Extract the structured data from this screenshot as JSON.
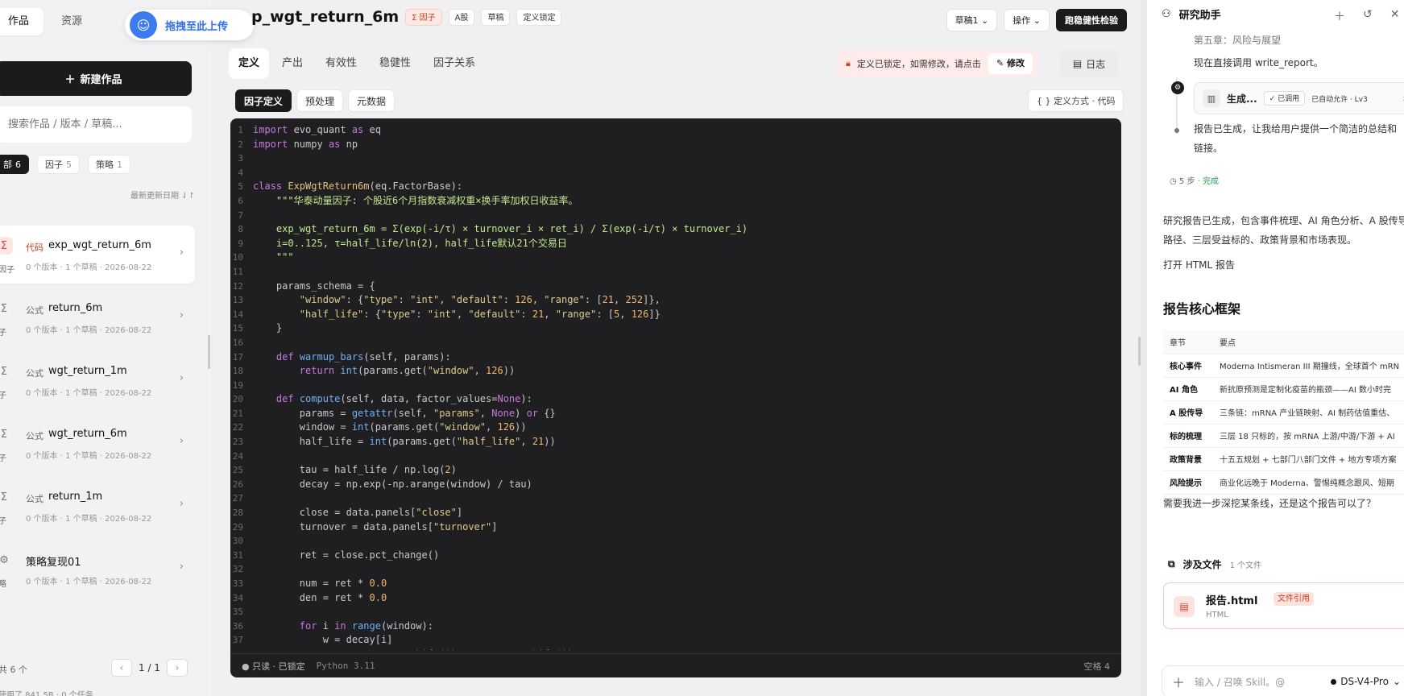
{
  "left": {
    "tabs": [
      "作品",
      "资源"
    ],
    "upload_label": "拖拽至此上传",
    "new_button": "新建作品",
    "search_placeholder": "搜索作品 / 版本 / 草稿...",
    "chips": [
      {
        "label": "部",
        "count": "6"
      },
      {
        "label": "因子",
        "count": "5"
      },
      {
        "label": "策略",
        "count": "1"
      }
    ],
    "sort_label": "最新更新日期 ⇃↾",
    "items": [
      {
        "icon": "Σ",
        "icon_label": "因子",
        "tag": "代码",
        "name": "exp_wgt_return_6m",
        "meta": "0 个版本 · 1 个草稿 · 2026-08-22"
      },
      {
        "icon": "Σ",
        "icon_label": "子",
        "tag": "公式",
        "name": "return_6m",
        "meta": "0 个版本 · 1 个草稿 · 2026-08-22"
      },
      {
        "icon": "Σ",
        "icon_label": "子",
        "tag": "公式",
        "name": "wgt_return_1m",
        "meta": "0 个版本 · 1 个草稿 · 2026-08-22"
      },
      {
        "icon": "Σ",
        "icon_label": "子",
        "tag": "公式",
        "name": "wgt_return_6m",
        "meta": "0 个版本 · 1 个草稿 · 2026-08-22"
      },
      {
        "icon": "Σ",
        "icon_label": "子",
        "tag": "公式",
        "name": "return_1m",
        "meta": "0 个版本 · 1 个草稿 · 2026-08-22"
      },
      {
        "icon": "⚙",
        "icon_label": "略",
        "tag": "",
        "name": "策略复现01",
        "meta": "0 个版本 · 1 个草稿 · 2026-08-22"
      }
    ],
    "total": "共 6 个",
    "page": "1 / 1",
    "footer": "使用了 841.5B · 0 个任务"
  },
  "main": {
    "title": "p_wgt_return_6m",
    "badges": [
      "Σ 因子",
      "A股",
      "草稿",
      "定义锁定"
    ],
    "draft_select": "草稿1 ⌄",
    "ops_select": "操作 ⌄",
    "robustness_button": "跑稳健性检验",
    "tabs": [
      "定义",
      "产出",
      "有效性",
      "稳健性",
      "因子关系"
    ],
    "lock_notice": "定义已锁定，如需修改，请点击",
    "edit_button": "✎ 修改",
    "log_button": "日志",
    "subtabs": [
      "因子定义",
      "预处理",
      "元数据"
    ],
    "def_mode": "{ } 定义方式 · 代码",
    "status": {
      "readonly": "● 只读 · 已锁定",
      "python": "Python 3.11",
      "spaces": "空格 4"
    }
  },
  "code_lines": [
    "<span class=\"k\">import</span> evo_quant <span class=\"k\">as</span> eq",
    "<span class=\"k\">import</span> numpy <span class=\"k\">as</span> np",
    "",
    "",
    "<span class=\"k\">class</span> <span class=\"c\">ExpWgtReturn6m</span>(eq.FactorBase):",
    "    <span class=\"s\">\"\"\"华泰动量因子: 个股近6个月指数衰减权重×换手率加权日收益率。</span>",
    "",
    "<span class=\"s\">    exp_wgt_return_6m = Σ(exp(-i/τ) × turnover_i × ret_i) / Σ(exp(-i/τ) × turnover_i)</span>",
    "<span class=\"s\">    i=0..125, τ=half_life/ln(2), half_life默认21个交易日</span>",
    "<span class=\"s\">    \"\"\"</span>",
    "",
    "    params_schema = {",
    "        <span class=\"st\">\"window\"</span>: {<span class=\"st\">\"type\"</span>: <span class=\"st\">\"int\"</span>, <span class=\"st\">\"default\"</span>: <span class=\"n\">126</span>, <span class=\"st\">\"range\"</span>: [<span class=\"n\">21</span>, <span class=\"n\">252</span>]},",
    "        <span class=\"st\">\"half_life\"</span>: {<span class=\"st\">\"type\"</span>: <span class=\"st\">\"int\"</span>, <span class=\"st\">\"default\"</span>: <span class=\"n\">21</span>, <span class=\"st\">\"range\"</span>: [<span class=\"n\">5</span>, <span class=\"n\">126</span>]}",
    "    }",
    "",
    "    <span class=\"k\">def</span> <span class=\"f\">warmup_bars</span>(self, params):",
    "        <span class=\"k\">return</span> <span class=\"f\">int</span>(params.get(<span class=\"st\">\"window\"</span>, <span class=\"n\">126</span>))",
    "",
    "    <span class=\"k\">def</span> <span class=\"f\">compute</span>(self, data, factor_values=<span class=\"k\">None</span>):",
    "        params = <span class=\"f\">getattr</span>(self, <span class=\"st\">\"params\"</span>, <span class=\"k\">None</span>) <span class=\"k\">or</span> {}",
    "        window = <span class=\"f\">int</span>(params.get(<span class=\"st\">\"window\"</span>, <span class=\"n\">126</span>))",
    "        half_life = <span class=\"f\">int</span>(params.get(<span class=\"st\">\"half_life\"</span>, <span class=\"n\">21</span>))",
    "",
    "        tau = half_life / np.log(<span class=\"n\">2</span>)",
    "        decay = np.exp(-np.arange(window) / tau)",
    "",
    "        close = data.panels[<span class=\"st\">\"close\"</span>]",
    "        turnover = data.panels[<span class=\"st\">\"turnover\"</span>]",
    "",
    "        ret = close.pct_change()",
    "",
    "        num = ret * <span class=\"n\">0.0</span>",
    "        den = ret * <span class=\"n\">0.0</span>",
    "",
    "        <span class=\"k\">for</span> i <span class=\"k\">in</span> <span class=\"f\">range</span>(window):",
    "            w = decay[i]",
    "            num += w * ret.shift(i) * turnover.shift(i)"
  ],
  "right": {
    "title": "研究助手",
    "line1": "第五章：风险与展望",
    "line2": "现在直接调用 write_report。",
    "tool_name": "生成...",
    "tool_badge1": "✓ 已调用",
    "tool_badge2": "已自动允许 · Lv3",
    "line3a": "报告已生成，让我给用户提供一个简洁的总结和",
    "line3b": "链接。",
    "steps": "5 步 ·",
    "steps_done": "完成",
    "summary": "研究报告已生成，包含事件梳理、AI 角色分析、A 股传导路径、三层受益标的、政策背景和市场表现。",
    "open_html": "打开 HTML 报告",
    "framework_title": "报告核心框架",
    "table_header": [
      "章节",
      "要点"
    ],
    "table_rows": [
      [
        "核心事件",
        "Moderna Intismeran III 期撞线，全球首个 mRN"
      ],
      [
        "AI 角色",
        "新抗原预测是定制化疫苗的瓶颈——AI 数小时完"
      ],
      [
        "A 股传导",
        "三条链：mRNA 产业链映射、AI 制药估值重估、"
      ],
      [
        "标的梳理",
        "三层 18 只标的，按 mRNA 上游/中游/下游 + AI"
      ],
      [
        "政策背景",
        "十五五规划 + 七部门八部门文件 + 地方专项方案"
      ],
      [
        "风险提示",
        "商业化远晚于 Moderna、警惕纯概念跟风、短期"
      ]
    ],
    "question": "需要我进一步深挖某条线，还是这个报告可以了？",
    "files_label": "涉及文件",
    "files_count": "1 个文件",
    "file_name": "报告.html",
    "file_badge": "文件引用",
    "file_type": "HTML",
    "input_placeholder": "输入 / 召唤 Skill。@",
    "model": "DS-V4-Pro"
  }
}
